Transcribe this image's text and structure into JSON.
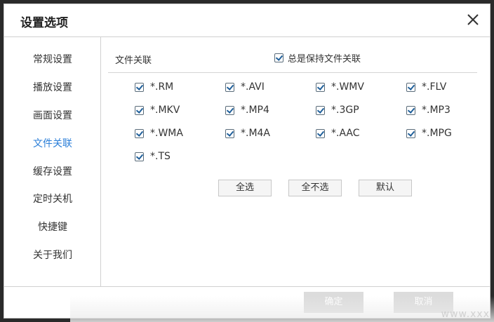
{
  "dialog": {
    "title": "设置选项",
    "close_icon": "close-icon"
  },
  "sidebar": {
    "items": [
      {
        "label": "常规设置",
        "active": false
      },
      {
        "label": "播放设置",
        "active": false
      },
      {
        "label": "画面设置",
        "active": false
      },
      {
        "label": "文件关联",
        "active": true
      },
      {
        "label": "缓存设置",
        "active": false
      },
      {
        "label": "定时关机",
        "active": false
      },
      {
        "label": "快捷键",
        "active": false
      },
      {
        "label": "关于我们",
        "active": false
      }
    ]
  },
  "file_assoc": {
    "section_label": "文件关联",
    "keep_label": "总是保持文件关联",
    "keep_checked": true,
    "extensions": [
      {
        "label": "*.RM",
        "checked": true
      },
      {
        "label": "*.AVI",
        "checked": true
      },
      {
        "label": "*.WMV",
        "checked": true
      },
      {
        "label": "*.FLV",
        "checked": true
      },
      {
        "label": "*.MKV",
        "checked": true
      },
      {
        "label": "*.MP4",
        "checked": true
      },
      {
        "label": "*.3GP",
        "checked": true
      },
      {
        "label": "*.MP3",
        "checked": true
      },
      {
        "label": "*.WMA",
        "checked": true
      },
      {
        "label": "*.M4A",
        "checked": true
      },
      {
        "label": "*.AAC",
        "checked": true
      },
      {
        "label": "*.MPG",
        "checked": true
      },
      {
        "label": "*.TS",
        "checked": true
      }
    ],
    "buttons": {
      "select_all": "全选",
      "select_none": "全不选",
      "default": "默认"
    }
  },
  "footer": {
    "ok_label": "确定",
    "cancel_label": "取消"
  },
  "watermark": "www.xxx",
  "colors": {
    "accent": "#2c7fd8",
    "checkmark": "#1f5f9a",
    "disabled_button": "#dcdcdc"
  }
}
